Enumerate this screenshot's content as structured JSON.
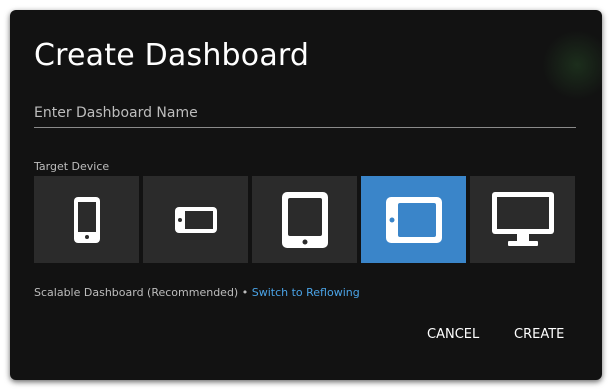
{
  "dialog": {
    "title": "Create Dashboard",
    "name_input": {
      "placeholder": "Enter Dashboard Name",
      "value": ""
    },
    "target_device_label": "Target Device",
    "devices": [
      {
        "icon": "phone-portrait-icon",
        "selected": false
      },
      {
        "icon": "phone-landscape-icon",
        "selected": false
      },
      {
        "icon": "tablet-portrait-icon",
        "selected": false
      },
      {
        "icon": "tablet-landscape-icon",
        "selected": true
      },
      {
        "icon": "desktop-monitor-icon",
        "selected": false
      }
    ],
    "mode_text": "Scalable Dashboard (Recommended) • ",
    "mode_link": "Switch to Reflowing",
    "buttons": {
      "cancel": "CANCEL",
      "create": "CREATE"
    }
  },
  "colors": {
    "dialog_bg": "#121212",
    "tile_bg": "#2b2b2b",
    "selected_tile": "#3a85c9",
    "link": "#4aa3e6"
  }
}
